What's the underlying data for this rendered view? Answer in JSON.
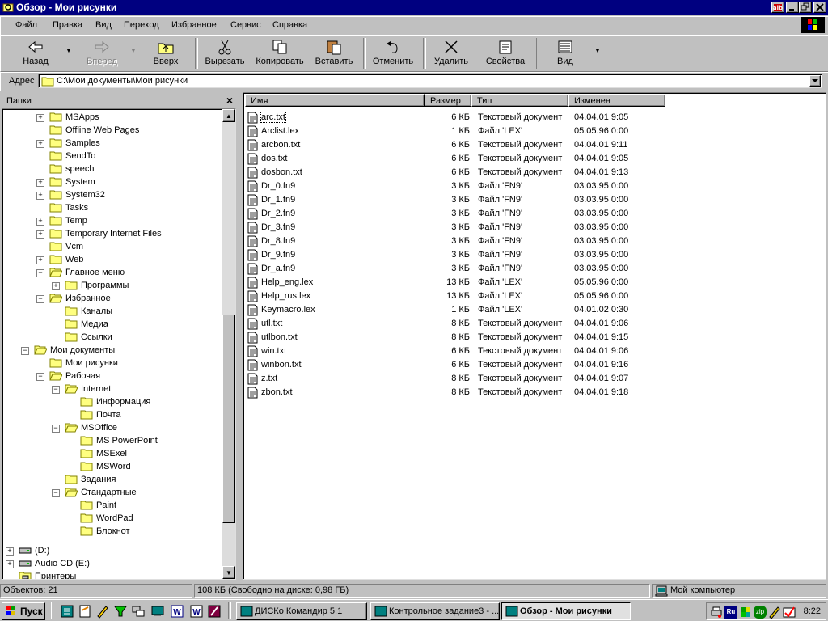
{
  "window": {
    "title": "Обзор - Мои рисунки"
  },
  "menu": [
    "Файл",
    "Правка",
    "Вид",
    "Переход",
    "Избранное",
    "Сервис",
    "Справка"
  ],
  "toolbar": {
    "back": "Назад",
    "forward": "Вперед",
    "up": "Вверх",
    "cut": "Вырезать",
    "copy": "Копировать",
    "paste": "Вставить",
    "undo": "Отменить",
    "delete": "Удалить",
    "properties": "Свойства",
    "view": "Вид"
  },
  "address": {
    "label": "Адрес",
    "value": "C:\\Мои документы\\Мои рисунки"
  },
  "folders_pane": {
    "title": "Папки",
    "close": "×",
    "tree": [
      {
        "label": "MSApps",
        "expander": "+"
      },
      {
        "label": "Offline Web Pages",
        "expander": ""
      },
      {
        "label": "Samples",
        "expander": "+"
      },
      {
        "label": "SendTo",
        "expander": ""
      },
      {
        "label": "speech",
        "expander": ""
      },
      {
        "label": "System",
        "expander": "+"
      },
      {
        "label": "System32",
        "expander": "+"
      },
      {
        "label": "Tasks",
        "expander": ""
      },
      {
        "label": "Temp",
        "expander": "+"
      },
      {
        "label": "Temporary Internet Files",
        "expander": "+"
      },
      {
        "label": "Vcm",
        "expander": ""
      },
      {
        "label": "Web",
        "expander": "+"
      },
      {
        "label": "Главное меню",
        "expander": "−"
      },
      {
        "label": "Программы",
        "expander": "+"
      },
      {
        "label": "Избранное",
        "expander": "−"
      },
      {
        "label": "Каналы",
        "expander": ""
      },
      {
        "label": "Медиа",
        "expander": ""
      },
      {
        "label": "Ссылки",
        "expander": ""
      },
      {
        "label": "Мои документы",
        "expander": "−"
      },
      {
        "label": "Мои рисунки",
        "expander": ""
      },
      {
        "label": "Рабочая",
        "expander": "−"
      },
      {
        "label": "Internet",
        "expander": "−"
      },
      {
        "label": "Информация",
        "expander": ""
      },
      {
        "label": "Почта",
        "expander": ""
      },
      {
        "label": "MSOffice",
        "expander": "−"
      },
      {
        "label": "MS PowerPoint",
        "expander": ""
      },
      {
        "label": "MSExel",
        "expander": ""
      },
      {
        "label": "MSWord",
        "expander": ""
      },
      {
        "label": "Задания",
        "expander": ""
      },
      {
        "label": "Стандартные",
        "expander": "−"
      },
      {
        "label": "Paint",
        "expander": ""
      },
      {
        "label": "WordPad",
        "expander": ""
      },
      {
        "label": "Блокнот",
        "expander": ""
      },
      {
        "label": "(D:)",
        "expander": "+"
      },
      {
        "label": "Audio CD (E:)",
        "expander": "+"
      },
      {
        "label": "Принтеры",
        "expander": ""
      }
    ]
  },
  "file_list": {
    "columns": [
      "Имя",
      "Размер",
      "Тип",
      "Изменен"
    ],
    "files": [
      {
        "name": "arc.txt",
        "size": "6 КБ",
        "type": "Текстовый документ",
        "modified": "04.04.01 9:05"
      },
      {
        "name": "Arclist.lex",
        "size": "1 КБ",
        "type": "Файл 'LEX'",
        "modified": "05.05.96 0:00"
      },
      {
        "name": "arcbon.txt",
        "size": "6 КБ",
        "type": "Текстовый документ",
        "modified": "04.04.01 9:11"
      },
      {
        "name": "dos.txt",
        "size": "6 КБ",
        "type": "Текстовый документ",
        "modified": "04.04.01 9:05"
      },
      {
        "name": "dosbon.txt",
        "size": "6 КБ",
        "type": "Текстовый документ",
        "modified": "04.04.01 9:13"
      },
      {
        "name": "Dr_0.fn9",
        "size": "3 КБ",
        "type": "Файл 'FN9'",
        "modified": "03.03.95 0:00"
      },
      {
        "name": "Dr_1.fn9",
        "size": "3 КБ",
        "type": "Файл 'FN9'",
        "modified": "03.03.95 0:00"
      },
      {
        "name": "Dr_2.fn9",
        "size": "3 КБ",
        "type": "Файл 'FN9'",
        "modified": "03.03.95 0:00"
      },
      {
        "name": "Dr_3.fn9",
        "size": "3 КБ",
        "type": "Файл 'FN9'",
        "modified": "03.03.95 0:00"
      },
      {
        "name": "Dr_8.fn9",
        "size": "3 КБ",
        "type": "Файл 'FN9'",
        "modified": "03.03.95 0:00"
      },
      {
        "name": "Dr_9.fn9",
        "size": "3 КБ",
        "type": "Файл 'FN9'",
        "modified": "03.03.95 0:00"
      },
      {
        "name": "Dr_a.fn9",
        "size": "3 КБ",
        "type": "Файл 'FN9'",
        "modified": "03.03.95 0:00"
      },
      {
        "name": "Help_eng.lex",
        "size": "13 КБ",
        "type": "Файл 'LEX'",
        "modified": "05.05.96 0:00"
      },
      {
        "name": "Help_rus.lex",
        "size": "13 КБ",
        "type": "Файл 'LEX'",
        "modified": "05.05.96 0:00"
      },
      {
        "name": "Keymacro.lex",
        "size": "1 КБ",
        "type": "Файл 'LEX'",
        "modified": "04.01.02 0:30"
      },
      {
        "name": "utl.txt",
        "size": "8 КБ",
        "type": "Текстовый документ",
        "modified": "04.04.01 9:06"
      },
      {
        "name": "utlbon.txt",
        "size": "8 КБ",
        "type": "Текстовый документ",
        "modified": "04.04.01 9:15"
      },
      {
        "name": "win.txt",
        "size": "6 КБ",
        "type": "Текстовый документ",
        "modified": "04.04.01 9:06"
      },
      {
        "name": "winbon.txt",
        "size": "6 КБ",
        "type": "Текстовый документ",
        "modified": "04.04.01 9:16"
      },
      {
        "name": "z.txt",
        "size": "8 КБ",
        "type": "Текстовый документ",
        "modified": "04.04.01 9:07"
      },
      {
        "name": "zbon.txt",
        "size": "8 КБ",
        "type": "Текстовый документ",
        "modified": "04.04.01 9:18"
      }
    ]
  },
  "status": {
    "objects": "Объектов: 21",
    "size": "108 КБ (Свободно на диске: 0,98 ГБ)",
    "location": "Мой компьютер"
  },
  "taskbar": {
    "start": "Пуск",
    "tasks": [
      {
        "label": "ДИСКо Командир 5.1",
        "active": false
      },
      {
        "label": "Контрольное задание3 - ...",
        "active": false
      },
      {
        "label": "Обзор - Мои рисунки",
        "active": true
      }
    ],
    "tray_lang": "Ru",
    "tray_zip": "zip",
    "clock": "8:22"
  },
  "colors": {
    "titlebar": "#000080",
    "face": "#c0c0c0",
    "window": "#ffffff",
    "folder": "#ffff80"
  }
}
